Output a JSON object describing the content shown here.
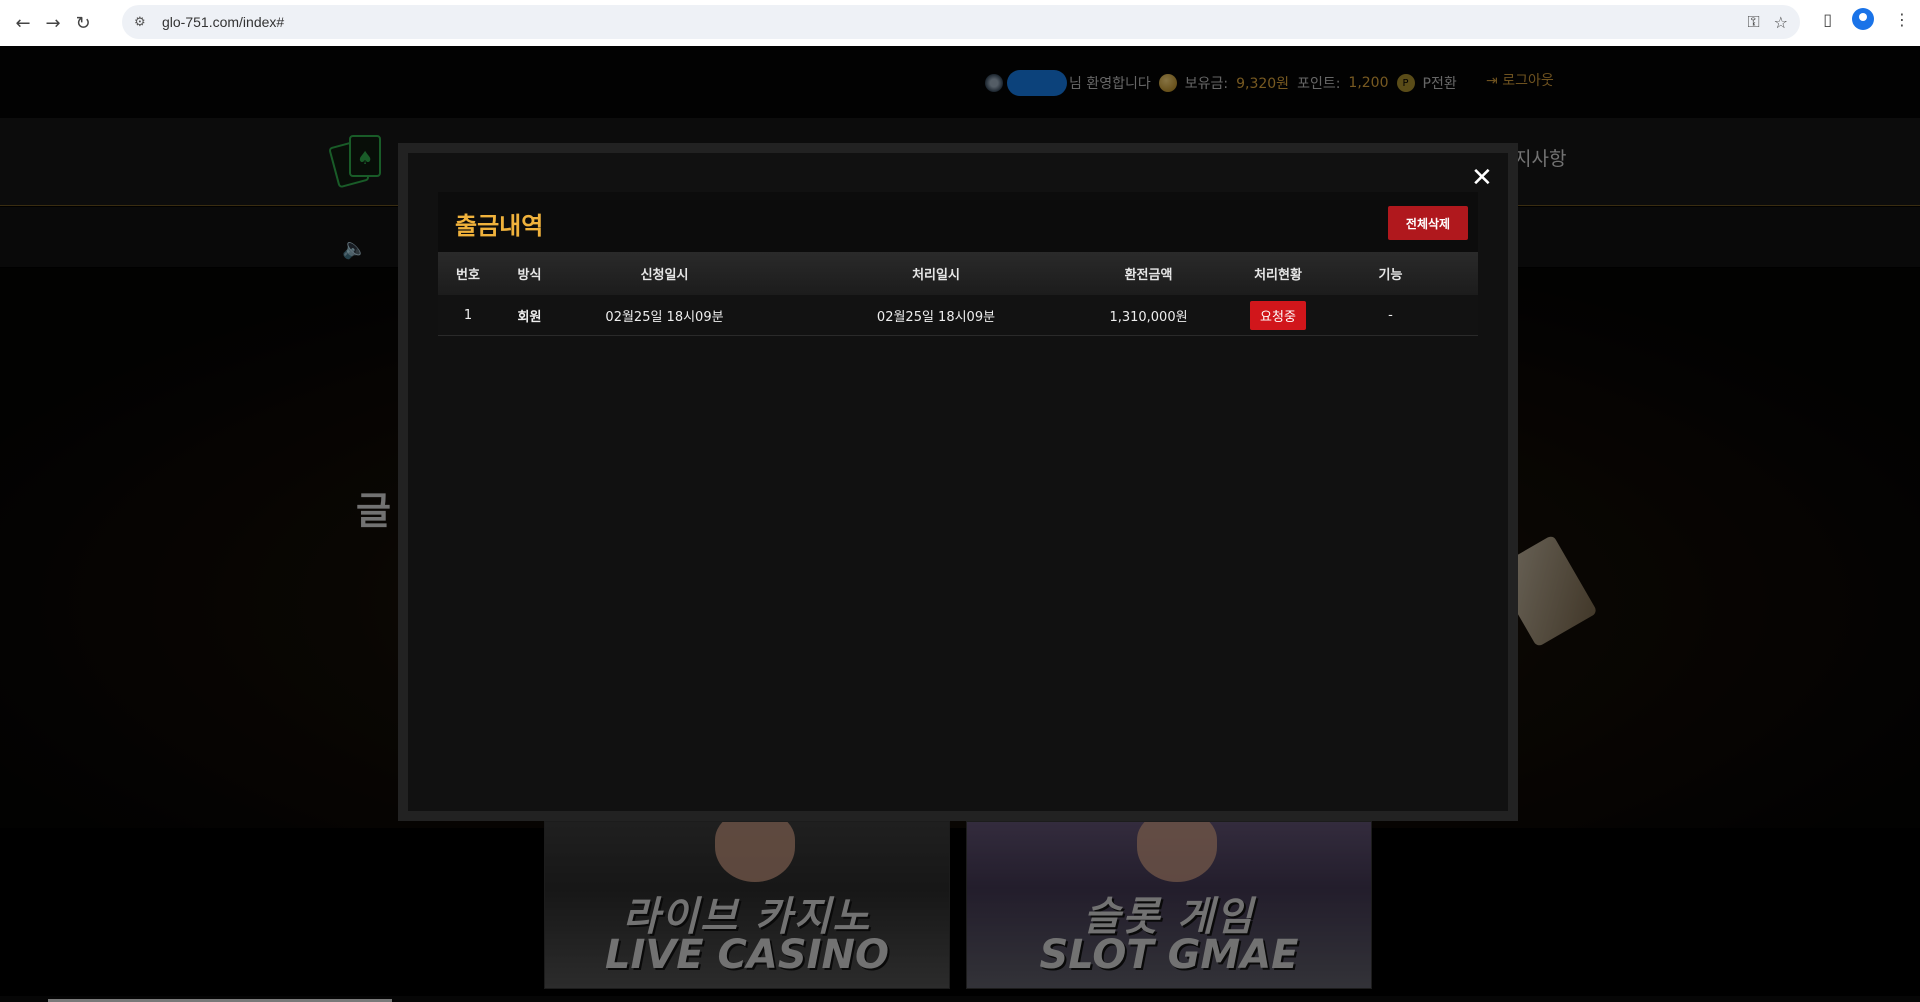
{
  "browser": {
    "url": "glo-751.com/index#"
  },
  "topbar": {
    "welcome": "님 환영합니다",
    "balance_label": "보유금:",
    "balance_value": "9,320원",
    "points_label": "포인트:",
    "points_value": "1,200",
    "convert_label": "P전환",
    "logout_label": "로그아웃"
  },
  "navbar": {
    "partial_menu": "지사항"
  },
  "hero": {
    "partial_text": "글"
  },
  "banners": [
    {
      "title_ko": "라이브 카지노",
      "title_en": "LIVE CASINO"
    },
    {
      "title_ko": "슬롯 게임",
      "title_en": "SLOT GMAE"
    }
  ],
  "modal": {
    "title": "출금내역",
    "delete_all_label": "전체삭제",
    "close_symbol": "✕",
    "columns": [
      "번호",
      "방식",
      "신청일시",
      "처리일시",
      "환전금액",
      "처리현황",
      "기능"
    ],
    "rows": [
      {
        "no": "1",
        "method": "회원",
        "requested": "02월25일 18시09분",
        "processed": "02월25일 18시09분",
        "amount": "1,310,000원",
        "status": "요청중",
        "action": "-"
      }
    ]
  },
  "colors": {
    "accent_gold": "#f0b23c",
    "status_red": "#d1161b",
    "delete_red": "#b0181d"
  }
}
